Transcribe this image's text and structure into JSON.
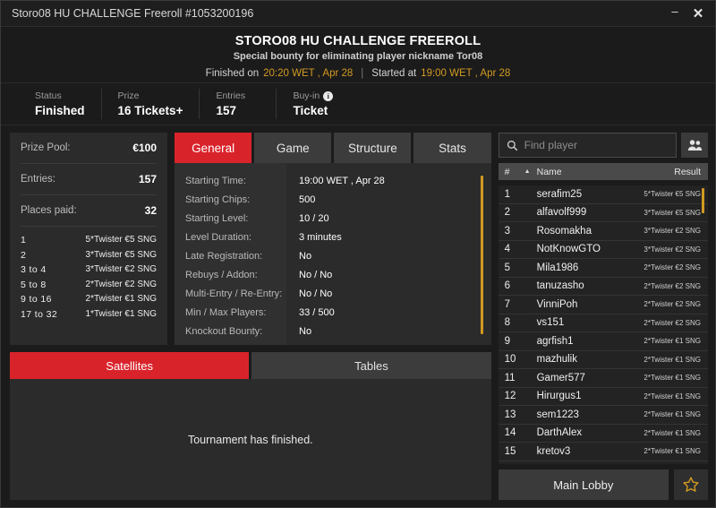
{
  "titlebar": {
    "title": "Storo08 HU CHALLENGE Freeroll #1053200196",
    "minimize": "–",
    "close": "✕"
  },
  "header": {
    "title": "STORO08 HU CHALLENGE FREEROLL",
    "subtitle": "Special bounty for eliminating player nickname Tor08",
    "finished_prefix": "Finished on",
    "finished_time": "20:20 WET , Apr 28",
    "divider": "|",
    "started_prefix": "Started at",
    "started_time": "19:00 WET , Apr 28"
  },
  "status_strip": [
    {
      "label": "Status",
      "value": "Finished",
      "info": false
    },
    {
      "label": "Prize",
      "value": "16 Tickets+",
      "info": false
    },
    {
      "label": "Entries",
      "value": "157",
      "info": false
    },
    {
      "label": "Buy-in",
      "value": "Ticket",
      "info": true
    }
  ],
  "prize_panel": {
    "rows": [
      {
        "key": "Prize Pool:",
        "value": "€100"
      },
      {
        "key": "Entries:",
        "value": "157"
      },
      {
        "key": "Places paid:",
        "value": "32"
      }
    ],
    "payouts": [
      {
        "place": "1",
        "award": "5*Twister €5 SNG"
      },
      {
        "place": "2",
        "award": "3*Twister €5 SNG"
      },
      {
        "place": "3  to  4",
        "award": "3*Twister €2 SNG"
      },
      {
        "place": "5  to  8",
        "award": "2*Twister €2 SNG"
      },
      {
        "place": "9  to  16",
        "award": "2*Twister €1 SNG"
      },
      {
        "place": "17  to  32",
        "award": "1*Twister €1 SNG"
      }
    ]
  },
  "info_tabs": {
    "tabs": [
      {
        "label": "General",
        "active": true
      },
      {
        "label": "Game",
        "active": false
      },
      {
        "label": "Structure",
        "active": false
      },
      {
        "label": "Stats",
        "active": false
      }
    ],
    "general_rows": [
      {
        "label": "Starting Time:",
        "value": "19:00 WET , Apr 28"
      },
      {
        "label": "Starting Chips:",
        "value": "500"
      },
      {
        "label": "Starting Level:",
        "value": "10 / 20"
      },
      {
        "label": "Level Duration:",
        "value": "3 minutes"
      },
      {
        "label": "Late Registration:",
        "value": "No"
      },
      {
        "label": "Rebuys / Addon:",
        "value": "No / No"
      },
      {
        "label": "Multi-Entry / Re-Entry:",
        "value": "No / No"
      },
      {
        "label": "Min / Max Players:",
        "value": "33 / 500"
      },
      {
        "label": "Knockout Bounty:",
        "value": "No"
      }
    ]
  },
  "bottom_tabs": {
    "tabs": [
      {
        "label": "Satellites",
        "active": true
      },
      {
        "label": "Tables",
        "active": false
      }
    ],
    "message": "Tournament has finished."
  },
  "players_panel": {
    "search_placeholder": "Find player",
    "search_value": "",
    "search_icon": "search-icon",
    "people_icon": "people-icon",
    "columns": {
      "num": "#",
      "sort_arrow": "▲",
      "name": "Name",
      "result": "Result"
    },
    "rows": [
      {
        "num": "1",
        "name": "serafim25",
        "result": "5*Twister €5 SNG"
      },
      {
        "num": "2",
        "name": "alfavolf999",
        "result": "3*Twister €5 SNG"
      },
      {
        "num": "3",
        "name": "Rosomakha",
        "result": "3*Twister €2 SNG"
      },
      {
        "num": "4",
        "name": "NotKnowGTO",
        "result": "3*Twister €2 SNG"
      },
      {
        "num": "5",
        "name": "Mila1986",
        "result": "2*Twister €2 SNG"
      },
      {
        "num": "6",
        "name": "tanuzasho",
        "result": "2*Twister €2 SNG"
      },
      {
        "num": "7",
        "name": "VinniPoh",
        "result": "2*Twister €2 SNG"
      },
      {
        "num": "8",
        "name": "vs151",
        "result": "2*Twister €2 SNG"
      },
      {
        "num": "9",
        "name": "agrfish1",
        "result": "2*Twister €1 SNG"
      },
      {
        "num": "10",
        "name": "mazhulik",
        "result": "2*Twister €1 SNG"
      },
      {
        "num": "11",
        "name": "Gamer577",
        "result": "2*Twister €1 SNG"
      },
      {
        "num": "12",
        "name": "Hirurgus1",
        "result": "2*Twister €1 SNG"
      },
      {
        "num": "13",
        "name": "sem1223",
        "result": "2*Twister €1 SNG"
      },
      {
        "num": "14",
        "name": "DarthAlex",
        "result": "2*Twister €1 SNG"
      },
      {
        "num": "15",
        "name": "kretov3",
        "result": "2*Twister €1 SNG"
      }
    ],
    "lobby_button": "Main Lobby",
    "favorite_icon": "star-icon"
  },
  "colors": {
    "accent_red": "#d9232b",
    "accent_gold": "#d29a22",
    "panel_bg": "#2b2b2b",
    "window_bg": "#1b1b1b",
    "list_bg": "#232323"
  }
}
